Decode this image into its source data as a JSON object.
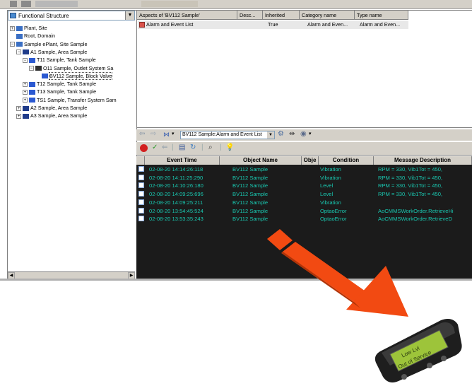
{
  "left_pane": {
    "structure_select": "Functional Structure",
    "tree": [
      {
        "label": "Plant, Site",
        "expander": "+",
        "depth": 0,
        "color": "#3a6fc4"
      },
      {
        "label": "Root, Domain",
        "expander": "",
        "depth": 0,
        "color": "#3a6fc4"
      },
      {
        "label": "Sample ePlant, Site Sample",
        "expander": "-",
        "depth": 0,
        "color": "#3a6fc4"
      },
      {
        "label": "A1 Sample, Area Sample",
        "expander": "-",
        "depth": 1,
        "color": "#1f3b8a"
      },
      {
        "label": "T11 Sample, Tank Sample",
        "expander": "-",
        "depth": 2,
        "color": "#2b59d1"
      },
      {
        "label": "O11 Sample, Outlet System Sa",
        "expander": "-",
        "depth": 3,
        "color": "#303030"
      },
      {
        "label": "BV112 Sample, Block Valve",
        "expander": "",
        "depth": 4,
        "color": "#2b59d1",
        "selected": true
      },
      {
        "label": "T12 Sample, Tank Sample",
        "expander": "+",
        "depth": 2,
        "color": "#2b59d1"
      },
      {
        "label": "T13 Sample, Tank Sample",
        "expander": "+",
        "depth": 2,
        "color": "#2b59d1"
      },
      {
        "label": "TS1 Sample, Transfer System Sam",
        "expander": "+",
        "depth": 2,
        "color": "#2b59d1"
      },
      {
        "label": "A2 Sample, Area Sample",
        "expander": "+",
        "depth": 1,
        "color": "#1f3b8a"
      },
      {
        "label": "A3 Sample, Area Sample",
        "expander": "+",
        "depth": 1,
        "color": "#1f3b8a"
      }
    ]
  },
  "aspects": {
    "columns": [
      "Aspects of 'BV112 Sample'",
      "Desc...",
      "Inherited",
      "Category name",
      "Type name"
    ],
    "rows": [
      {
        "aspect": "Alarm and Event List",
        "desc": "",
        "inherited": "True",
        "category": "Alarm and Even...",
        "type": "Alarm and Even..."
      }
    ]
  },
  "toolbar": {
    "list_select": "BV112 Sample:Alarm and Event List"
  },
  "events": {
    "columns": [
      "Event Time",
      "Object Name",
      "Obje",
      "Condition",
      "Message Description"
    ],
    "rows": [
      {
        "time": "02-08-20 14:14:26:118",
        "object": "BV112 Sample",
        "obj2": "",
        "condition": "Vibration",
        "message": "RPM = 330, Vib1Tot = 450,"
      },
      {
        "time": "02-08-20 14:11:25:290",
        "object": "BV112 Sample",
        "obj2": "",
        "condition": "Vibration",
        "message": "RPM = 330, Vib1Tot = 450,"
      },
      {
        "time": "02-08-20 14:10:26:180",
        "object": "BV112 Sample",
        "obj2": "",
        "condition": "Level",
        "message": "RPM = 330, Vib1Tot = 450,"
      },
      {
        "time": "02-08-20 14:09:25:696",
        "object": "BV112 Sample",
        "obj2": "",
        "condition": "Level",
        "message": "RPM = 330, Vib1Tot = 450,"
      },
      {
        "time": "02-08-20 14:09:25:211",
        "object": "BV112 Sample",
        "obj2": "",
        "condition": "Vibration",
        "message": ""
      },
      {
        "time": "02-08-20 13:54:45:524",
        "object": "BV112 Sample",
        "obj2": "",
        "condition": "OptaoError",
        "message": "AoCMMSWorkOrder.RetrieveHi"
      },
      {
        "time": "02-08-20 13:53:35:243",
        "object": "BV112 Sample",
        "obj2": "",
        "condition": "OptaoError",
        "message": "AoCMMSWorkOrder.RetrieveD"
      }
    ]
  },
  "pager": {
    "line1": "Low Lvl",
    "line2": "Out of Service"
  },
  "colors": {
    "event_text": "#19c7b0",
    "event_bg": "#1b1b1b",
    "arrow": "#f24a12",
    "pager_screen": "#9dc43a"
  }
}
